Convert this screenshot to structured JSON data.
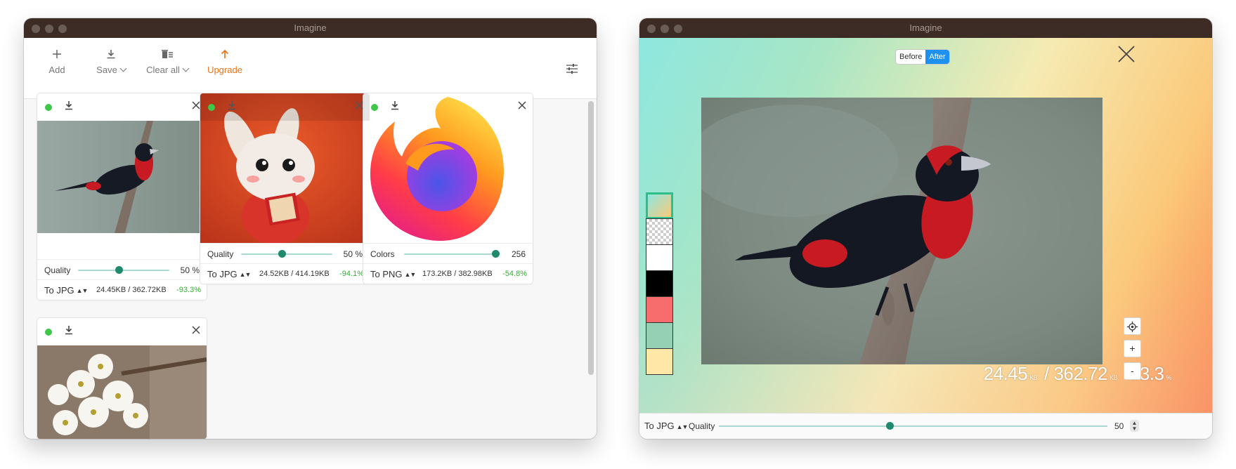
{
  "left_window": {
    "title": "Imagine",
    "toolbar": {
      "add_label": "Add",
      "save_label": "Save",
      "clear_label": "Clear all",
      "upgrade_label": "Upgrade"
    },
    "cards": [
      {
        "slider_label": "Quality",
        "slider_value": "50 %",
        "slider_level": 0.45,
        "format": "To JPG",
        "size": "24.45KB / 362.72KB",
        "reduction": "-93.3%"
      },
      {
        "slider_label": "Quality",
        "slider_value": "50 %",
        "slider_level": 0.45,
        "format": "To JPG",
        "size": "24.52KB / 414.19KB",
        "reduction": "-94.1%"
      },
      {
        "slider_label": "Colors",
        "slider_value": "256",
        "slider_level": 1.0,
        "format": "To PNG",
        "size": "173.2KB / 382.98KB",
        "reduction": "-54.8%"
      }
    ]
  },
  "right_window": {
    "title": "Imagine",
    "toggle": {
      "before": "Before",
      "after": "After",
      "active": "After"
    },
    "stats": {
      "compressed": "24.45",
      "compressed_unit": "KB",
      "separator": "/",
      "original": "362.72",
      "original_unit": "KB",
      "reduction": "-93.3",
      "reduction_unit": "%"
    },
    "zoom_in": "+",
    "zoom_out": "-",
    "bottom": {
      "format": "To JPG",
      "quality_label": "Quality",
      "quality_value": "50",
      "quality_level": 0.44
    },
    "swatch_colors": [
      "gradient",
      "checker",
      "#ffffff",
      "#000000",
      "#f76c6c",
      "#96d0b4",
      "#ffe7a8"
    ]
  },
  "colors": {
    "accent": "#1f8a6e",
    "upgrade": "#e8741a",
    "success": "#2db32d",
    "titlebar": "#3d2c26"
  }
}
